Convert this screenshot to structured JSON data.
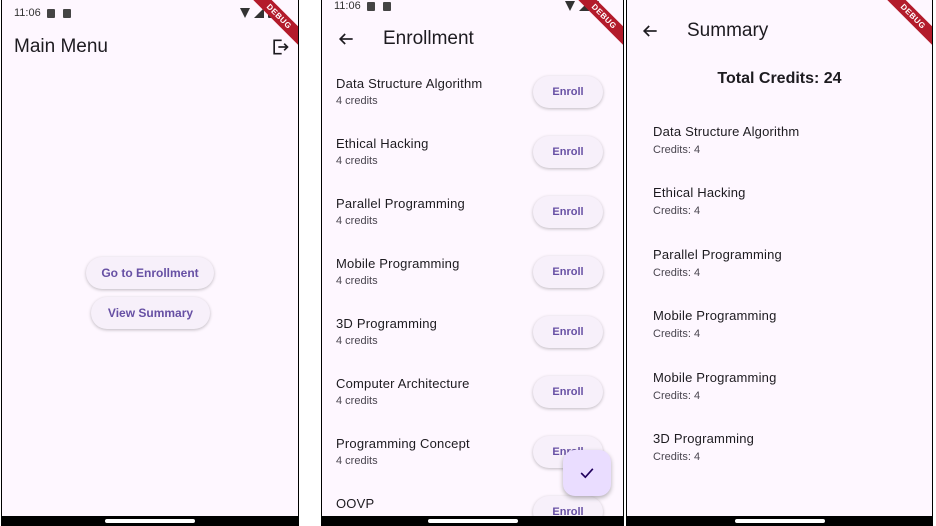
{
  "main": {
    "time": "11:06",
    "title": "Main Menu",
    "go_enrollment": "Go to Enrollment",
    "view_summary": "View Summary",
    "debug": "DEBUG"
  },
  "enroll": {
    "time": "11:06",
    "title": "Enrollment",
    "button_label": "Enroll",
    "courses": [
      {
        "name": "Data Structure Algorithm",
        "credits": "4 credits"
      },
      {
        "name": "Ethical Hacking",
        "credits": "4 credits"
      },
      {
        "name": "Parallel Programming",
        "credits": "4 credits"
      },
      {
        "name": "Mobile Programming",
        "credits": "4 credits"
      },
      {
        "name": "3D Programming",
        "credits": "4 credits"
      },
      {
        "name": "Computer Architecture",
        "credits": "4 credits"
      },
      {
        "name": "Programming Concept",
        "credits": "4 credits"
      },
      {
        "name": "OOVP",
        "credits": ""
      }
    ],
    "debug": "DEBUG"
  },
  "summary": {
    "title": "Summary",
    "total": "Total Credits: 24",
    "items": [
      {
        "name": "Data Structure Algorithm",
        "credits": "Credits: 4"
      },
      {
        "name": "Ethical Hacking",
        "credits": "Credits: 4"
      },
      {
        "name": "Parallel Programming",
        "credits": "Credits: 4"
      },
      {
        "name": "Mobile Programming",
        "credits": "Credits: 4"
      },
      {
        "name": "Mobile Programming",
        "credits": "Credits: 4"
      },
      {
        "name": "3D Programming",
        "credits": "Credits: 4"
      }
    ],
    "debug": "DEBUG"
  }
}
